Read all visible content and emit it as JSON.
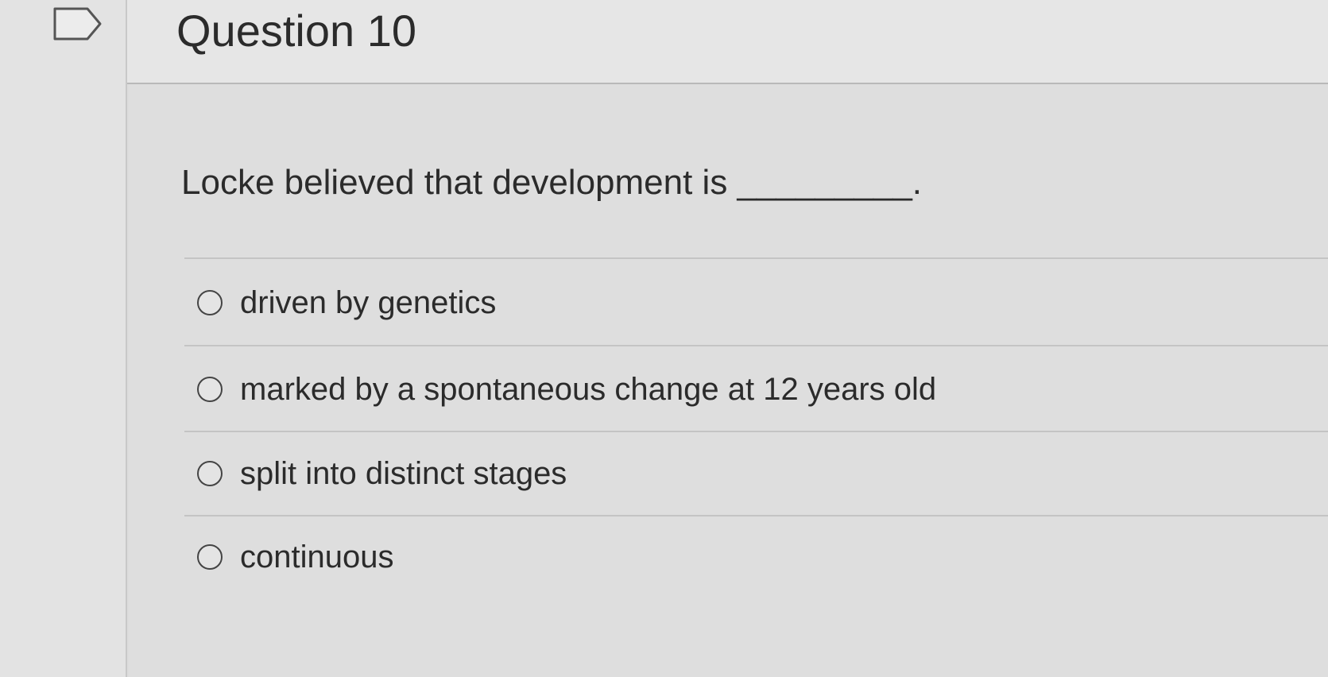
{
  "question": {
    "title": "Question 10",
    "text": "Locke believed that development is _________.",
    "answers": [
      {
        "label": "driven by genetics",
        "selected": false
      },
      {
        "label": "marked by a spontaneous change at 12 years old",
        "selected": false
      },
      {
        "label": "split into distinct stages",
        "selected": false
      },
      {
        "label": "continuous",
        "selected": false
      }
    ]
  },
  "icons": {
    "flag": "flag-question-icon",
    "radio": "radio-button-icon"
  }
}
